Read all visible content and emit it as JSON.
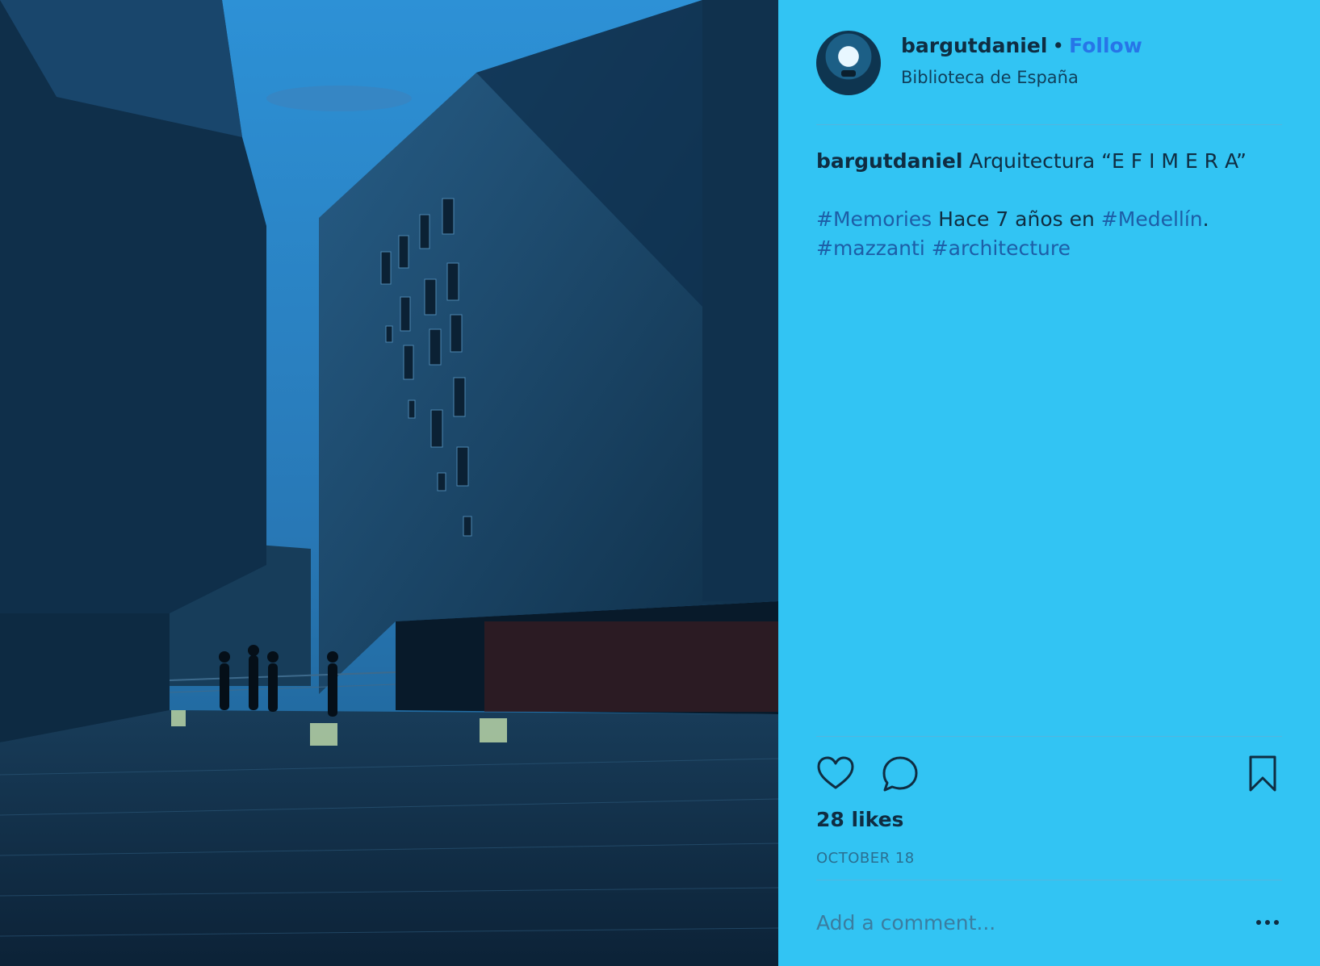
{
  "post": {
    "author": {
      "username": "bargutdaniel",
      "follow_label": "Follow",
      "separator": "•",
      "location": "Biblioteca de España"
    },
    "caption": {
      "username": "bargutdaniel",
      "text": "Arquitectura “E F I M E R A”",
      "line2_tag1": "#Memories",
      "line2_text": "Hace 7 años en",
      "line2_tag2": "#Medellín",
      "line2_end": ".",
      "line3_tag1": "#mazzanti",
      "line3_tag2": "#architecture"
    },
    "likes": "28 likes",
    "date": "OCTOBER 18",
    "comment_placeholder": "Add a comment..."
  },
  "icons": {
    "like": "heart-icon",
    "comment": "comment-icon",
    "save": "bookmark-icon",
    "more": "more-options-icon"
  },
  "colors": {
    "panel_background": "#32c4f3",
    "follow": "#2775e8",
    "hashtag": "#1d5ea7",
    "text": "#0f2d42"
  }
}
